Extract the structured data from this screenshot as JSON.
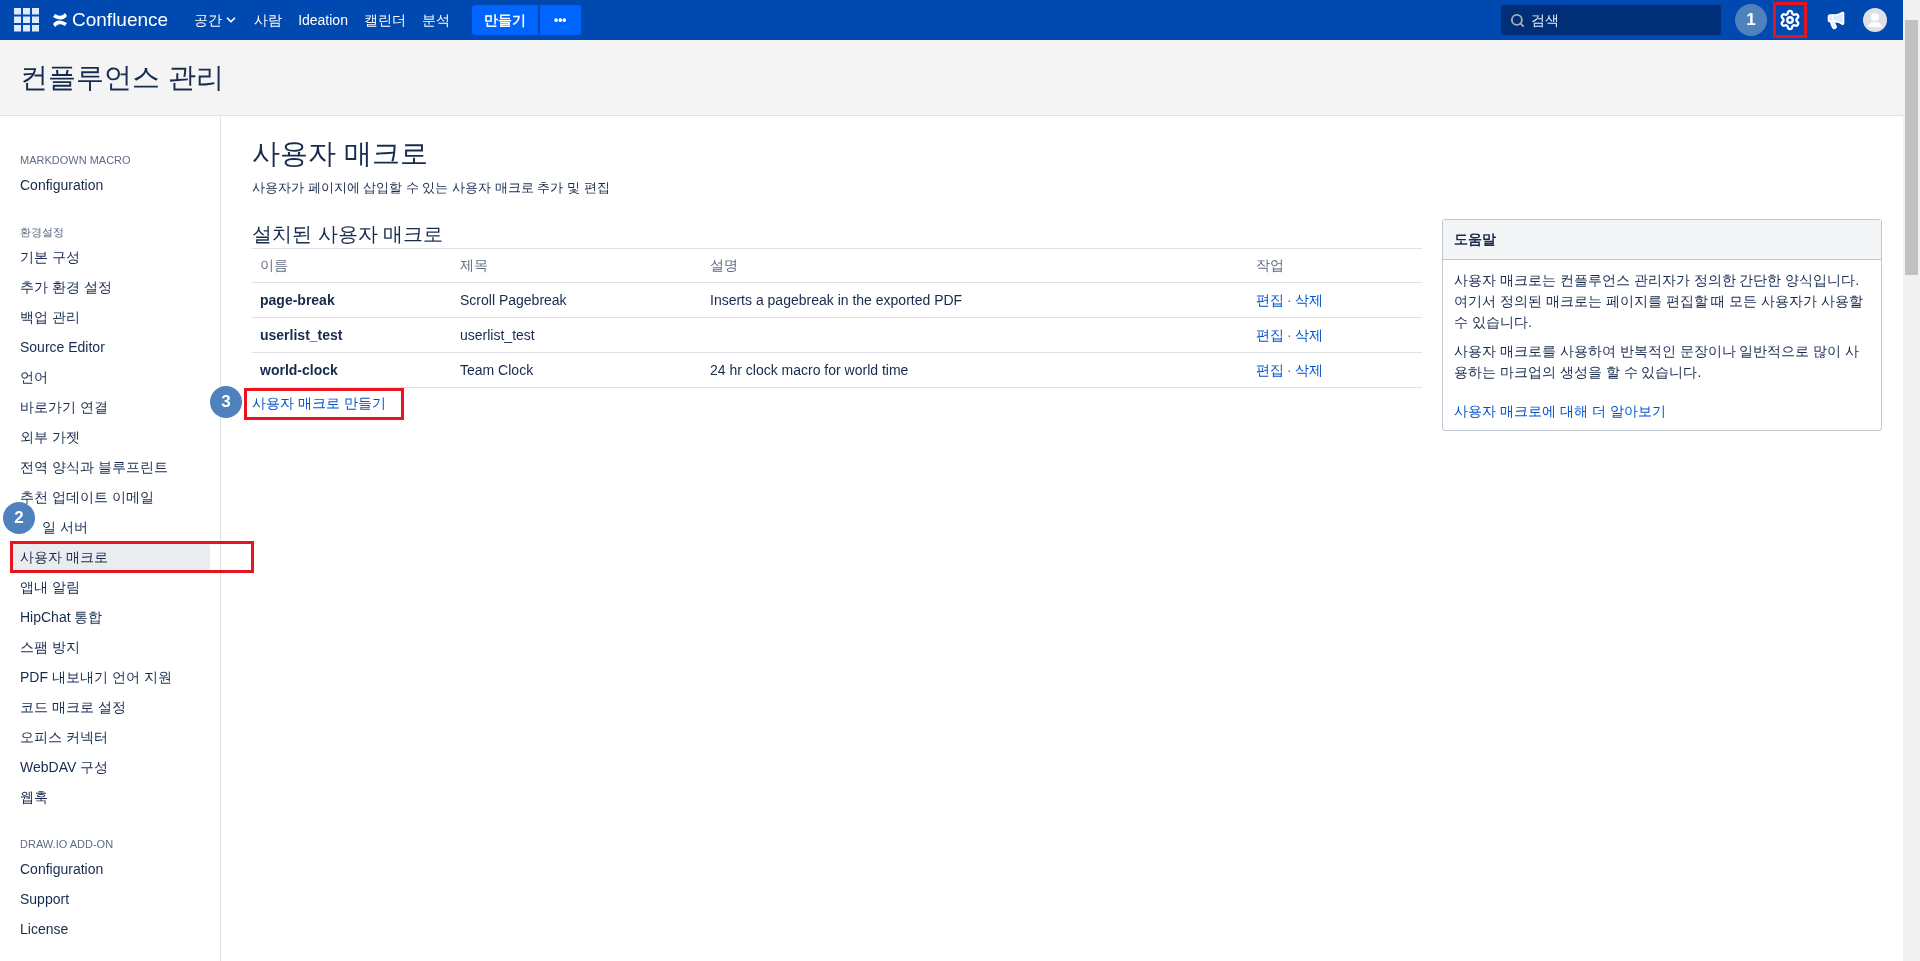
{
  "nav": {
    "brand": "Confluence",
    "menu": [
      {
        "label": "공간",
        "dropdown": true
      },
      {
        "label": "사람",
        "dropdown": false
      },
      {
        "label": "Ideation",
        "dropdown": false
      },
      {
        "label": "캘린더",
        "dropdown": false
      },
      {
        "label": "분석",
        "dropdown": false
      }
    ],
    "create_button": "만들기",
    "more_button": "•••",
    "search": {
      "placeholder": "검색"
    },
    "settings": {
      "marker": "1",
      "highlighted": true
    }
  },
  "header": {
    "title": "컨플루언스 관리"
  },
  "sidebar": {
    "sections": [
      {
        "heading": "MARKDOWN MACRO",
        "items": [
          {
            "label": "Configuration",
            "selected": false
          }
        ]
      },
      {
        "heading": "환경설정",
        "items": [
          {
            "label": "기본 구성",
            "selected": false
          },
          {
            "label": "추가 환경 설정",
            "selected": false
          },
          {
            "label": "백업 관리",
            "selected": false
          },
          {
            "label": "Source Editor",
            "selected": false
          },
          {
            "label": "언어",
            "selected": false
          },
          {
            "label": "바로가기 연결",
            "selected": false
          },
          {
            "label": "외부 가젯",
            "selected": false
          },
          {
            "label": "전역 양식과 블루프린트",
            "selected": false
          },
          {
            "label": "추천 업데이트 이메일",
            "selected": false
          },
          {
            "label": "일 서버",
            "selected": false,
            "marker": "2"
          },
          {
            "label": "사용자 매크로",
            "selected": true,
            "highlighted": true
          },
          {
            "label": "앱내 알림",
            "selected": false
          },
          {
            "label": "HipChat 통합",
            "selected": false
          },
          {
            "label": "스팸 방지",
            "selected": false
          },
          {
            "label": "PDF 내보내기 언어 지원",
            "selected": false
          },
          {
            "label": "코드 매크로 설정",
            "selected": false
          },
          {
            "label": "오피스 커넥터",
            "selected": false
          },
          {
            "label": "WebDAV 구성",
            "selected": false
          },
          {
            "label": "웹훅",
            "selected": false
          }
        ]
      },
      {
        "heading": "DRAW.IO ADD-ON",
        "items": [
          {
            "label": "Configuration",
            "selected": false
          },
          {
            "label": "Support",
            "selected": false
          },
          {
            "label": "License",
            "selected": false
          }
        ]
      }
    ]
  },
  "page": {
    "title": "사용자 매크로",
    "subtitle": "사용자가 페이지에 삽입할 수 있는 사용자 매크로 추가 및 편집",
    "section_title": "설치된 사용자 매크로",
    "table": {
      "columns": [
        "이름",
        "제목",
        "설명",
        "작업"
      ],
      "rows": [
        {
          "name": "page-break",
          "title": "Scroll Pagebreak",
          "description": "Inserts a pagebreak in the exported PDF",
          "actions": [
            "편집",
            "삭제"
          ]
        },
        {
          "name": "userlist_test",
          "title": "userlist_test",
          "actions": [
            "편집",
            "삭제"
          ]
        },
        {
          "name": "world-clock",
          "title": "Team Clock",
          "description": "24 hr clock macro for world time",
          "actions": [
            "편집",
            "삭제"
          ]
        }
      ],
      "action_separator": "·"
    },
    "create_link": {
      "label": "사용자 매크로 만들기",
      "marker": "3",
      "highlighted": true
    }
  },
  "help": {
    "title": "도움말",
    "paragraphs": [
      "사용자 매크로는 컨플루언스 관리자가 정의한 간단한 양식입니다. 여기서 정의된 매크로는 페이지를 편집할 때 모든 사용자가 사용할 수 있습니다.",
      "사용자 매크로를 사용하여 반복적인 문장이나 일반적으로 많이 사용하는 마크업의 생성을 할 수 있습니다."
    ],
    "link": "사용자 매크로에 대해 더 알아보기"
  }
}
